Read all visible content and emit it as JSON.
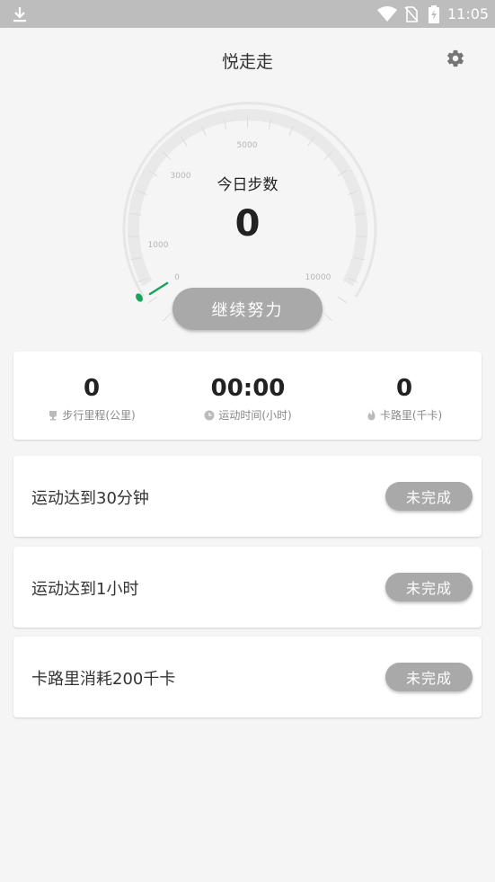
{
  "status_bar": {
    "time": "11:05"
  },
  "header": {
    "title": "悦走走"
  },
  "gauge": {
    "label": "今日步数",
    "value": "0",
    "ticks": [
      "0",
      "1000",
      "3000",
      "5000",
      "10000"
    ],
    "button_label": "继续努力",
    "accent_color": "#1aa35a"
  },
  "stats": [
    {
      "value": "0",
      "label": "步行里程(公里)",
      "icon": "trophy-icon"
    },
    {
      "value": "00:00",
      "label": "运动时间(小时)",
      "icon": "clock-icon"
    },
    {
      "value": "0",
      "label": "卡路里(千卡)",
      "icon": "flame-icon"
    }
  ],
  "tasks": [
    {
      "label": "运动达到30分钟",
      "status": "未完成"
    },
    {
      "label": "运动达到1小时",
      "status": "未完成"
    },
    {
      "label": "卡路里消耗200千卡",
      "status": "未完成"
    }
  ]
}
